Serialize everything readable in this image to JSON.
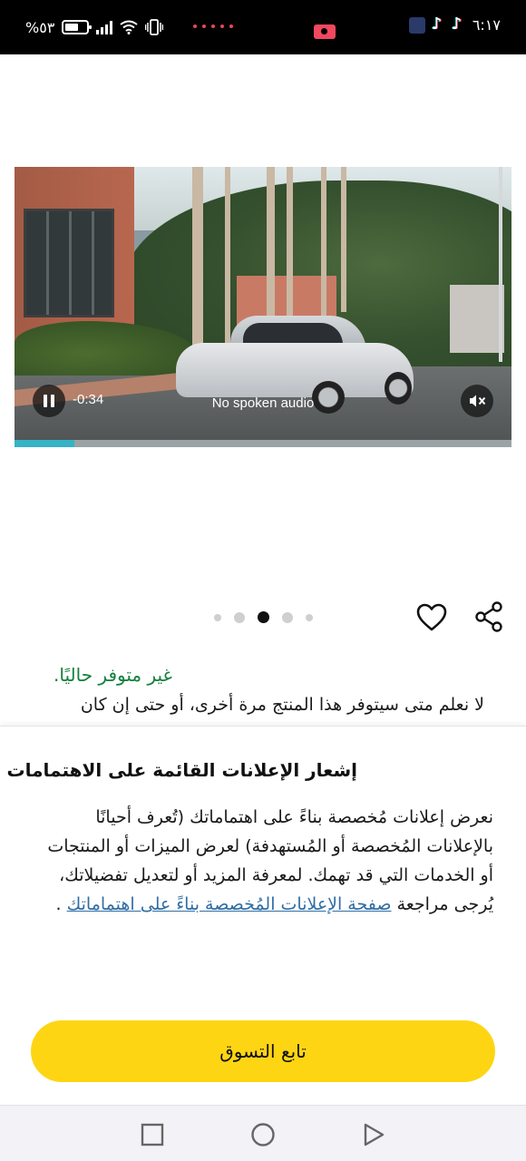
{
  "status_bar": {
    "battery_text": "%٥٣",
    "time": "٦:١٧"
  },
  "video": {
    "elapsed": "-0:34",
    "caption": "No spoken audio",
    "progress": 0.12,
    "icons": {
      "pause": "pause-icon",
      "mute": "mute-icon"
    }
  },
  "carousel": {
    "count": 5,
    "active_index": 2
  },
  "actions": {
    "icons": {
      "favorite": "heart-icon",
      "share": "share-icon"
    }
  },
  "availability": {
    "title": "غير متوفر حاليًا.",
    "description": "لا نعلم متى سيتوفر هذا المنتج مرة أخرى، أو حتى إن كان"
  },
  "sheet": {
    "title": "إشعار الإعلانات القائمة على الاهتمامات",
    "body_text": "نعرض إعلانات مُخصصة بناءً على اهتماماتك (تُعرف أحيانًا بالإعلانات المُخصصة أو المُستهدفة) لعرض الميزات أو المنتجات أو الخدمات التي قد تهمك. لمعرفة المزيد أو لتعديل تفضيلاتك، يُرجى مراجعة",
    "link_text": "صفحة الإعلانات المُخصصة بناءً على اهتماماتك",
    "end_text": ".",
    "button_label": "تابع التسوق"
  },
  "colors": {
    "accent_yellow": "#fed513",
    "availability_green": "#15803d",
    "link_blue": "#2f6ea5",
    "progress_teal": "#36b3c4"
  }
}
